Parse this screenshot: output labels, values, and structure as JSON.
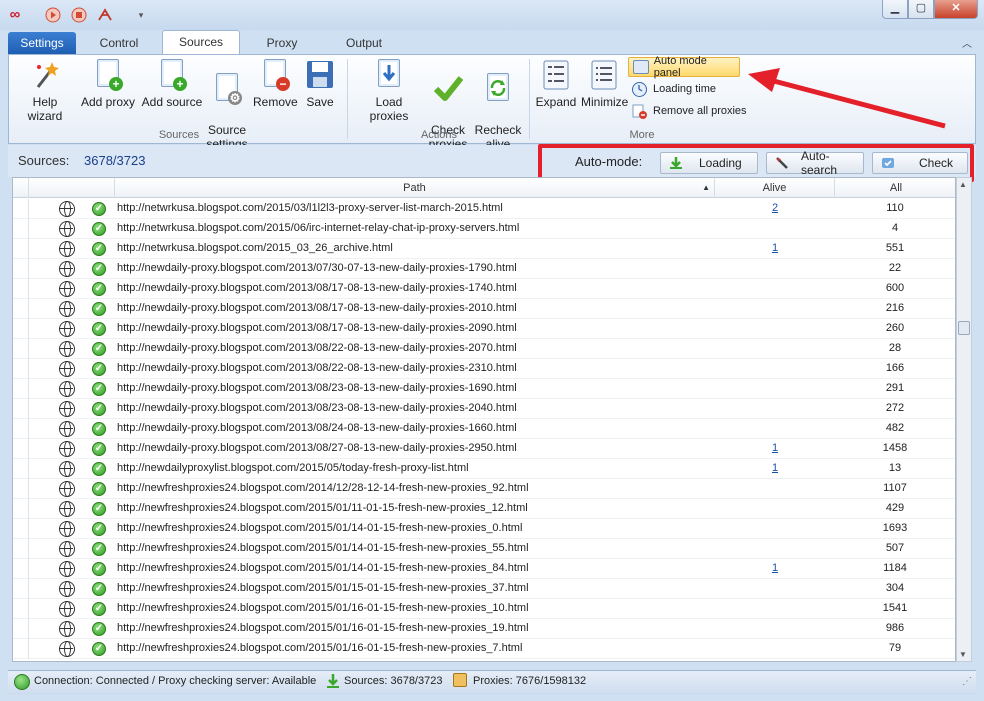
{
  "quick_access": [
    "infinity-icon",
    "play-icon",
    "stop-icon",
    "network-icon",
    "dropdown-icon"
  ],
  "window_buttons": {
    "minimize": "▁",
    "maximize": "▢",
    "close": "✕"
  },
  "tabs": [
    {
      "label": "Settings"
    },
    {
      "label": "Control"
    },
    {
      "label": "Sources"
    },
    {
      "label": "Proxy"
    },
    {
      "label": "Output"
    }
  ],
  "ribbon": {
    "sources_group": {
      "label": "Sources",
      "buttons": [
        {
          "label": "Help wizard"
        },
        {
          "label": "Add proxy"
        },
        {
          "label": "Add source"
        },
        {
          "label": "Source\nsettings"
        },
        {
          "label": "Remove"
        },
        {
          "label": "Save"
        }
      ]
    },
    "actions_group": {
      "label": "Actions",
      "buttons": [
        {
          "label": "Load proxies"
        },
        {
          "label": "Check\nproxies"
        },
        {
          "label": "Recheck\nalive"
        }
      ]
    },
    "more_group": {
      "label": "More",
      "buttons": [
        {
          "label": "Expand"
        },
        {
          "label": "Minimize"
        }
      ],
      "small": [
        {
          "label": "Auto mode panel"
        },
        {
          "label": "Loading time"
        },
        {
          "label": "Remove all proxies"
        }
      ]
    }
  },
  "sources_bar": {
    "label": "Sources:",
    "count": "3678/3723"
  },
  "auto_mode": {
    "label": "Auto-mode:",
    "loading": "Loading",
    "auto_search": "Auto-search",
    "check": "Check"
  },
  "table": {
    "columns": {
      "path": "Path",
      "alive": "Alive",
      "all": "All",
      "sort_indicator": "▲"
    },
    "rows": [
      {
        "path": "http://netwrkusa.blogspot.com/2015/03/l1l2l3-proxy-server-list-march-2015.html",
        "alive": "2",
        "all": "110"
      },
      {
        "path": "http://netwrkusa.blogspot.com/2015/06/irc-internet-relay-chat-ip-proxy-servers.html",
        "alive": "",
        "all": "4"
      },
      {
        "path": "http://netwrkusa.blogspot.com/2015_03_26_archive.html",
        "alive": "1",
        "all": "551"
      },
      {
        "path": "http://newdaily-proxy.blogspot.com/2013/07/30-07-13-new-daily-proxies-1790.html",
        "alive": "",
        "all": "22"
      },
      {
        "path": "http://newdaily-proxy.blogspot.com/2013/08/17-08-13-new-daily-proxies-1740.html",
        "alive": "",
        "all": "600"
      },
      {
        "path": "http://newdaily-proxy.blogspot.com/2013/08/17-08-13-new-daily-proxies-2010.html",
        "alive": "",
        "all": "216"
      },
      {
        "path": "http://newdaily-proxy.blogspot.com/2013/08/17-08-13-new-daily-proxies-2090.html",
        "alive": "",
        "all": "260"
      },
      {
        "path": "http://newdaily-proxy.blogspot.com/2013/08/22-08-13-new-daily-proxies-2070.html",
        "alive": "",
        "all": "28"
      },
      {
        "path": "http://newdaily-proxy.blogspot.com/2013/08/22-08-13-new-daily-proxies-2310.html",
        "alive": "",
        "all": "166"
      },
      {
        "path": "http://newdaily-proxy.blogspot.com/2013/08/23-08-13-new-daily-proxies-1690.html",
        "alive": "",
        "all": "291"
      },
      {
        "path": "http://newdaily-proxy.blogspot.com/2013/08/23-08-13-new-daily-proxies-2040.html",
        "alive": "",
        "all": "272"
      },
      {
        "path": "http://newdaily-proxy.blogspot.com/2013/08/24-08-13-new-daily-proxies-1660.html",
        "alive": "",
        "all": "482"
      },
      {
        "path": "http://newdaily-proxy.blogspot.com/2013/08/27-08-13-new-daily-proxies-2950.html",
        "alive": "1",
        "all": "1458"
      },
      {
        "path": "http://newdailyproxylist.blogspot.com/2015/05/today-fresh-proxy-list.html",
        "alive": "1",
        "all": "13"
      },
      {
        "path": "http://newfreshproxies24.blogspot.com/2014/12/28-12-14-fresh-new-proxies_92.html",
        "alive": "",
        "all": "1107"
      },
      {
        "path": "http://newfreshproxies24.blogspot.com/2015/01/11-01-15-fresh-new-proxies_12.html",
        "alive": "",
        "all": "429"
      },
      {
        "path": "http://newfreshproxies24.blogspot.com/2015/01/14-01-15-fresh-new-proxies_0.html",
        "alive": "",
        "all": "1693"
      },
      {
        "path": "http://newfreshproxies24.blogspot.com/2015/01/14-01-15-fresh-new-proxies_55.html",
        "alive": "",
        "all": "507"
      },
      {
        "path": "http://newfreshproxies24.blogspot.com/2015/01/14-01-15-fresh-new-proxies_84.html",
        "alive": "1",
        "all": "1184"
      },
      {
        "path": "http://newfreshproxies24.blogspot.com/2015/01/15-01-15-fresh-new-proxies_37.html",
        "alive": "",
        "all": "304"
      },
      {
        "path": "http://newfreshproxies24.blogspot.com/2015/01/16-01-15-fresh-new-proxies_10.html",
        "alive": "",
        "all": "1541"
      },
      {
        "path": "http://newfreshproxies24.blogspot.com/2015/01/16-01-15-fresh-new-proxies_19.html",
        "alive": "",
        "all": "986"
      },
      {
        "path": "http://newfreshproxies24.blogspot.com/2015/01/16-01-15-fresh-new-proxies_7.html",
        "alive": "",
        "all": "79"
      }
    ]
  },
  "status_bar": {
    "connection": "Connection: Connected / Proxy checking server: Available",
    "sources": "Sources: 3678/3723",
    "proxies": "Proxies: 7676/1598132"
  },
  "colors": {
    "accent": "#1f5fb3",
    "highlight_box": "#e4202a",
    "ok_green": "#2e9b24",
    "link": "#1b4fa8"
  }
}
